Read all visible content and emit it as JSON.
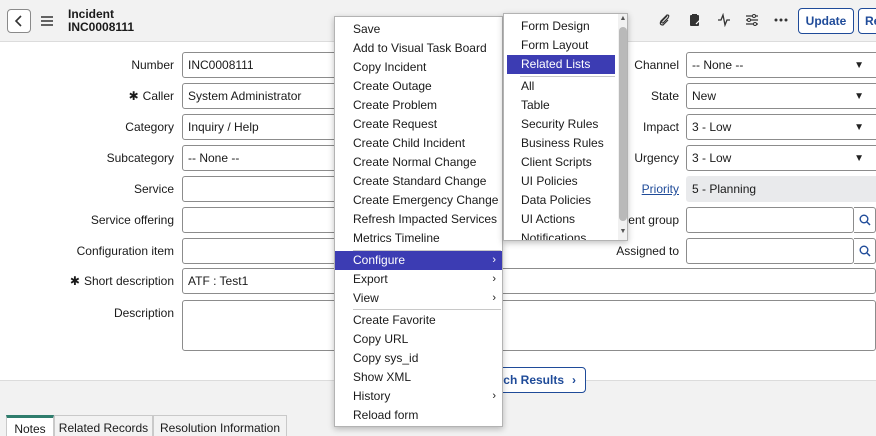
{
  "header": {
    "record_type": "Incident",
    "record_number": "INC0008111",
    "update_label": "Update",
    "resolve_label_partial": "Re"
  },
  "form": {
    "number": {
      "label": "Number",
      "value": "INC0008111"
    },
    "caller": {
      "label": "Caller",
      "value": "System Administrator",
      "mandatory": true
    },
    "category": {
      "label": "Category",
      "value": "Inquiry / Help"
    },
    "subcategory": {
      "label": "Subcategory",
      "value": "-- None --"
    },
    "service": {
      "label": "Service",
      "value": ""
    },
    "service_offering": {
      "label": "Service offering",
      "value": ""
    },
    "configuration_item": {
      "label": "Configuration item",
      "value": ""
    },
    "short_description": {
      "label": "Short description",
      "value": "ATF : Test1",
      "mandatory": true
    },
    "description": {
      "label": "Description",
      "value": ""
    },
    "channel": {
      "label": "Channel",
      "value": "-- None --"
    },
    "state": {
      "label": "State",
      "value": "New"
    },
    "impact": {
      "label": "Impact",
      "value": "3 - Low"
    },
    "urgency": {
      "label": "Urgency",
      "value": "3 - Low"
    },
    "priority": {
      "label": "Priority",
      "value": "5 - Planning"
    },
    "assignment_group": {
      "label_partial": "nent group",
      "value": ""
    },
    "assigned_to": {
      "label": "Assigned to",
      "value": ""
    },
    "mandatory_marker": "✱"
  },
  "footer": {
    "search_results_partial": "rch Results",
    "tabs": [
      "Notes",
      "Related Records",
      "Resolution Information"
    ]
  },
  "context_menu": {
    "items": [
      "Save",
      "Add to Visual Task Board",
      "Copy Incident",
      "Create Outage",
      "Create Problem",
      "Create Request",
      "Create Child Incident",
      "Create Normal Change",
      "Create Standard Change",
      "Create Emergency Change",
      "Refresh Impacted Services",
      "Metrics Timeline",
      "Configure",
      "Export",
      "View",
      "Create Favorite",
      "Copy URL",
      "Copy sys_id",
      "Show XML",
      "History",
      "Reload form"
    ],
    "selected": "Configure"
  },
  "configure_submenu": {
    "items": [
      "Form Design",
      "Form Layout",
      "Related Lists",
      "All",
      "Table",
      "Security Rules",
      "Business Rules",
      "Client Scripts",
      "UI Policies",
      "Data Policies",
      "UI Actions",
      "Notifications"
    ],
    "selected": "Related Lists"
  },
  "colors": {
    "menu_highlight": "#3c3cb3",
    "brand_blue": "#1f4b99",
    "active_tab": "#2f7d6d"
  }
}
